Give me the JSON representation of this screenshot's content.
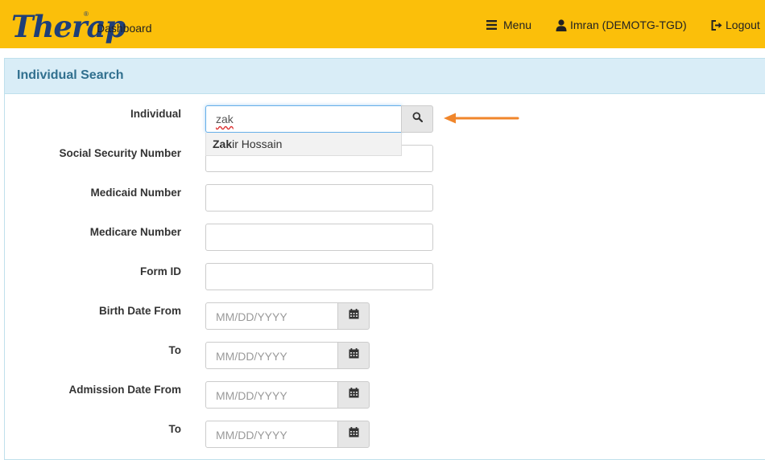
{
  "header": {
    "logo_text": "Therap",
    "logo_reg": "®",
    "dashboard": "Dashboard",
    "menu": "Menu",
    "user": "Imran (DEMOTG-TGD)",
    "logout": "Logout",
    "bg_color": "#fbbf0a",
    "logo_color": "#1f3f78"
  },
  "panel": {
    "title": "Individual Search",
    "title_color": "#31708f",
    "header_bg": "#d9edf7"
  },
  "form": {
    "individual": {
      "label": "Individual",
      "value": "zak"
    },
    "suggestion": {
      "match": "Zak",
      "rest": "ir Hossain"
    },
    "ssn": {
      "label": "Social Security Number",
      "value": ""
    },
    "medicaid": {
      "label": "Medicaid Number",
      "value": ""
    },
    "medicare": {
      "label": "Medicare Number",
      "value": ""
    },
    "form_id": {
      "label": "Form ID",
      "value": ""
    },
    "birth_from": {
      "label": "Birth Date From",
      "placeholder": "MM/DD/YYYY"
    },
    "birth_to": {
      "label": "To",
      "placeholder": "MM/DD/YYYY"
    },
    "admission_from": {
      "label": "Admission Date From",
      "placeholder": "MM/DD/YYYY"
    },
    "admission_to": {
      "label": "To",
      "placeholder": "MM/DD/YYYY"
    }
  },
  "icons": {
    "search": "search-icon",
    "calendar": "calendar-icon",
    "menu": "hamburger-icon",
    "user": "user-icon",
    "logout": "logout-icon",
    "arrow_color": "#f0862b"
  }
}
